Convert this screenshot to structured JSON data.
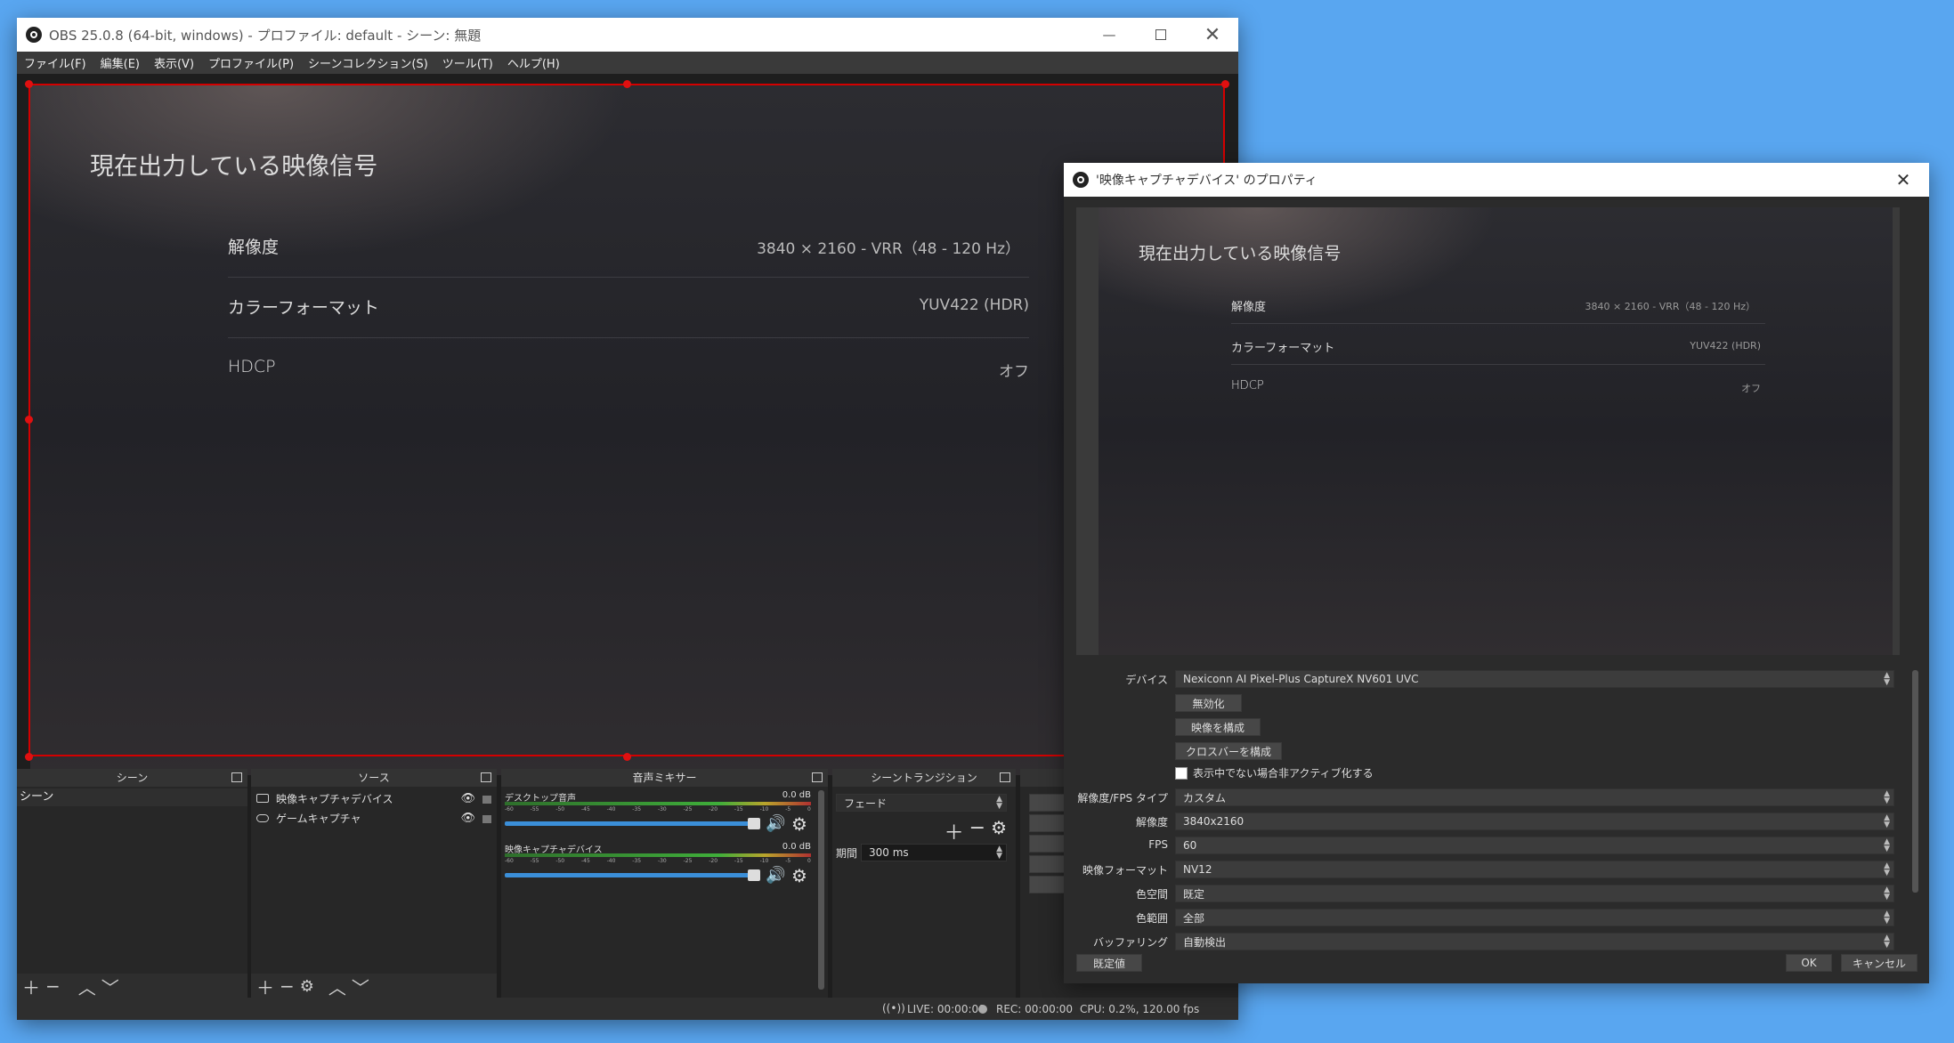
{
  "obs": {
    "title": "OBS 25.0.8 (64-bit, windows) - プロファイル: default - シーン: 無題",
    "menu": [
      "ファイル(F)",
      "編集(E)",
      "表示(V)",
      "プロファイル(P)",
      "シーンコレクション(S)",
      "ツール(T)",
      "ヘルプ(H)"
    ],
    "preview": {
      "heading": "現在出力している映像信号",
      "rows": [
        {
          "label": "解像度",
          "value": "3840 × 2160 - VRR（48 - 120 Hz）"
        },
        {
          "label": "カラーフォーマット",
          "value": "YUV422 (HDR)"
        },
        {
          "label": "HDCP",
          "value": "オフ"
        }
      ]
    },
    "docks": {
      "scenes": {
        "title": "シーン",
        "items": [
          "シーン"
        ]
      },
      "sources": {
        "title": "ソース",
        "items": [
          {
            "name": "映像キャプチャデバイス",
            "icon": "camera-icon"
          },
          {
            "name": "ゲームキャプチャ",
            "icon": "gamepad-icon"
          }
        ]
      },
      "mixer": {
        "title": "音声ミキサー",
        "channels": [
          {
            "name": "デスクトップ音声",
            "db": "0.0 dB",
            "level": 0.97
          },
          {
            "name": "映像キャプチャデバイス",
            "db": "0.0 dB",
            "level": 0.97
          }
        ],
        "scale": [
          "-60",
          "-55",
          "-50",
          "-45",
          "-40",
          "-35",
          "-30",
          "-25",
          "-20",
          "-15",
          "-10",
          "-5",
          "0"
        ]
      },
      "transitions": {
        "title": "シーントランジション",
        "transition": "フェード",
        "duration_label": "期間",
        "duration": "300 ms"
      }
    },
    "status": {
      "live": "LIVE: 00:00:00",
      "rec": "REC: 00:00:00",
      "cpu": "CPU: 0.2%, 120.00 fps"
    }
  },
  "props": {
    "title": "'映像キャプチャデバイス' のプロパティ",
    "preview": {
      "heading": "現在出力している映像信号",
      "rows": [
        {
          "label": "解像度",
          "value": "3840 × 2160 - VRR（48 - 120 Hz）"
        },
        {
          "label": "カラーフォーマット",
          "value": "YUV422 (HDR)"
        },
        {
          "label": "HDCP",
          "value": "オフ"
        }
      ]
    },
    "device_label": "デバイス",
    "device": "Nexiconn AI Pixel-Plus CaptureX NV601 UVC",
    "buttons": [
      "無効化",
      "映像を構成",
      "クロスバーを構成"
    ],
    "checkbox": "表示中でない場合非アクティブ化する",
    "fields": [
      {
        "label": "解像度/FPS タイプ",
        "value": "カスタム"
      },
      {
        "label": "解像度",
        "value": "3840x2160"
      },
      {
        "label": "FPS",
        "value": "60"
      },
      {
        "label": "映像フォーマット",
        "value": "NV12"
      },
      {
        "label": "色空間",
        "value": "既定"
      },
      {
        "label": "色範囲",
        "value": "全部"
      },
      {
        "label": "バッファリング",
        "value": "自動検出"
      }
    ],
    "defaults_button": "既定値",
    "ok_button": "OK",
    "cancel_button": "キャンセル"
  },
  "colors": {
    "desktop": "#59a6f0",
    "selection": "#d40000",
    "obs_bg": "#2b2b2b",
    "meter_green": "#3fae3a",
    "slider_blue": "#3b8fd9"
  }
}
